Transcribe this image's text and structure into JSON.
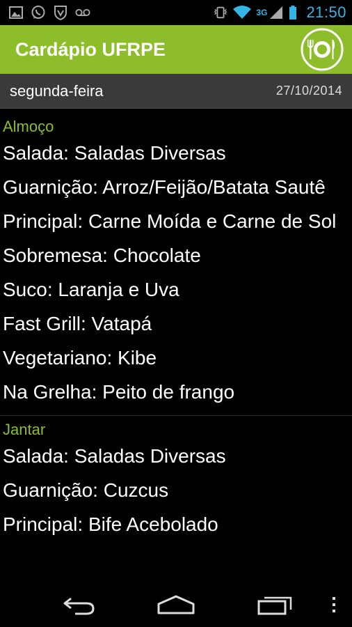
{
  "status_bar": {
    "left_icons": [
      "image-icon",
      "whatsapp-icon",
      "shield-icon",
      "voicemail-icon"
    ],
    "network_label": "3G",
    "time": "21:50"
  },
  "app_bar": {
    "title": "Cardápio UFRPE",
    "logo_icon": "plate-cutlery-icon",
    "accent_color": "#8dbd2b"
  },
  "day_header": {
    "day": "segunda-feira",
    "date": "27/10/2014"
  },
  "meals": [
    {
      "title": "Almoço",
      "items": [
        "Salada: Saladas Diversas",
        "Guarnição: Arroz/Feijão/Batata Sautê",
        "Principal: Carne Moída e Carne de Sol",
        "Sobremesa: Chocolate",
        "Suco: Laranja e Uva",
        "Fast Grill: Vatapá",
        "Vegetariano: Kibe",
        "Na Grelha: Peito de frango"
      ]
    },
    {
      "title": "Jantar",
      "items": [
        "Salada: Saladas Diversas",
        "Guarnição: Cuzcus",
        "Principal: Bife Acebolado"
      ]
    }
  ],
  "nav_bar": {
    "buttons": [
      "back-icon",
      "home-icon",
      "recent-apps-icon",
      "overflow-menu-icon"
    ]
  }
}
